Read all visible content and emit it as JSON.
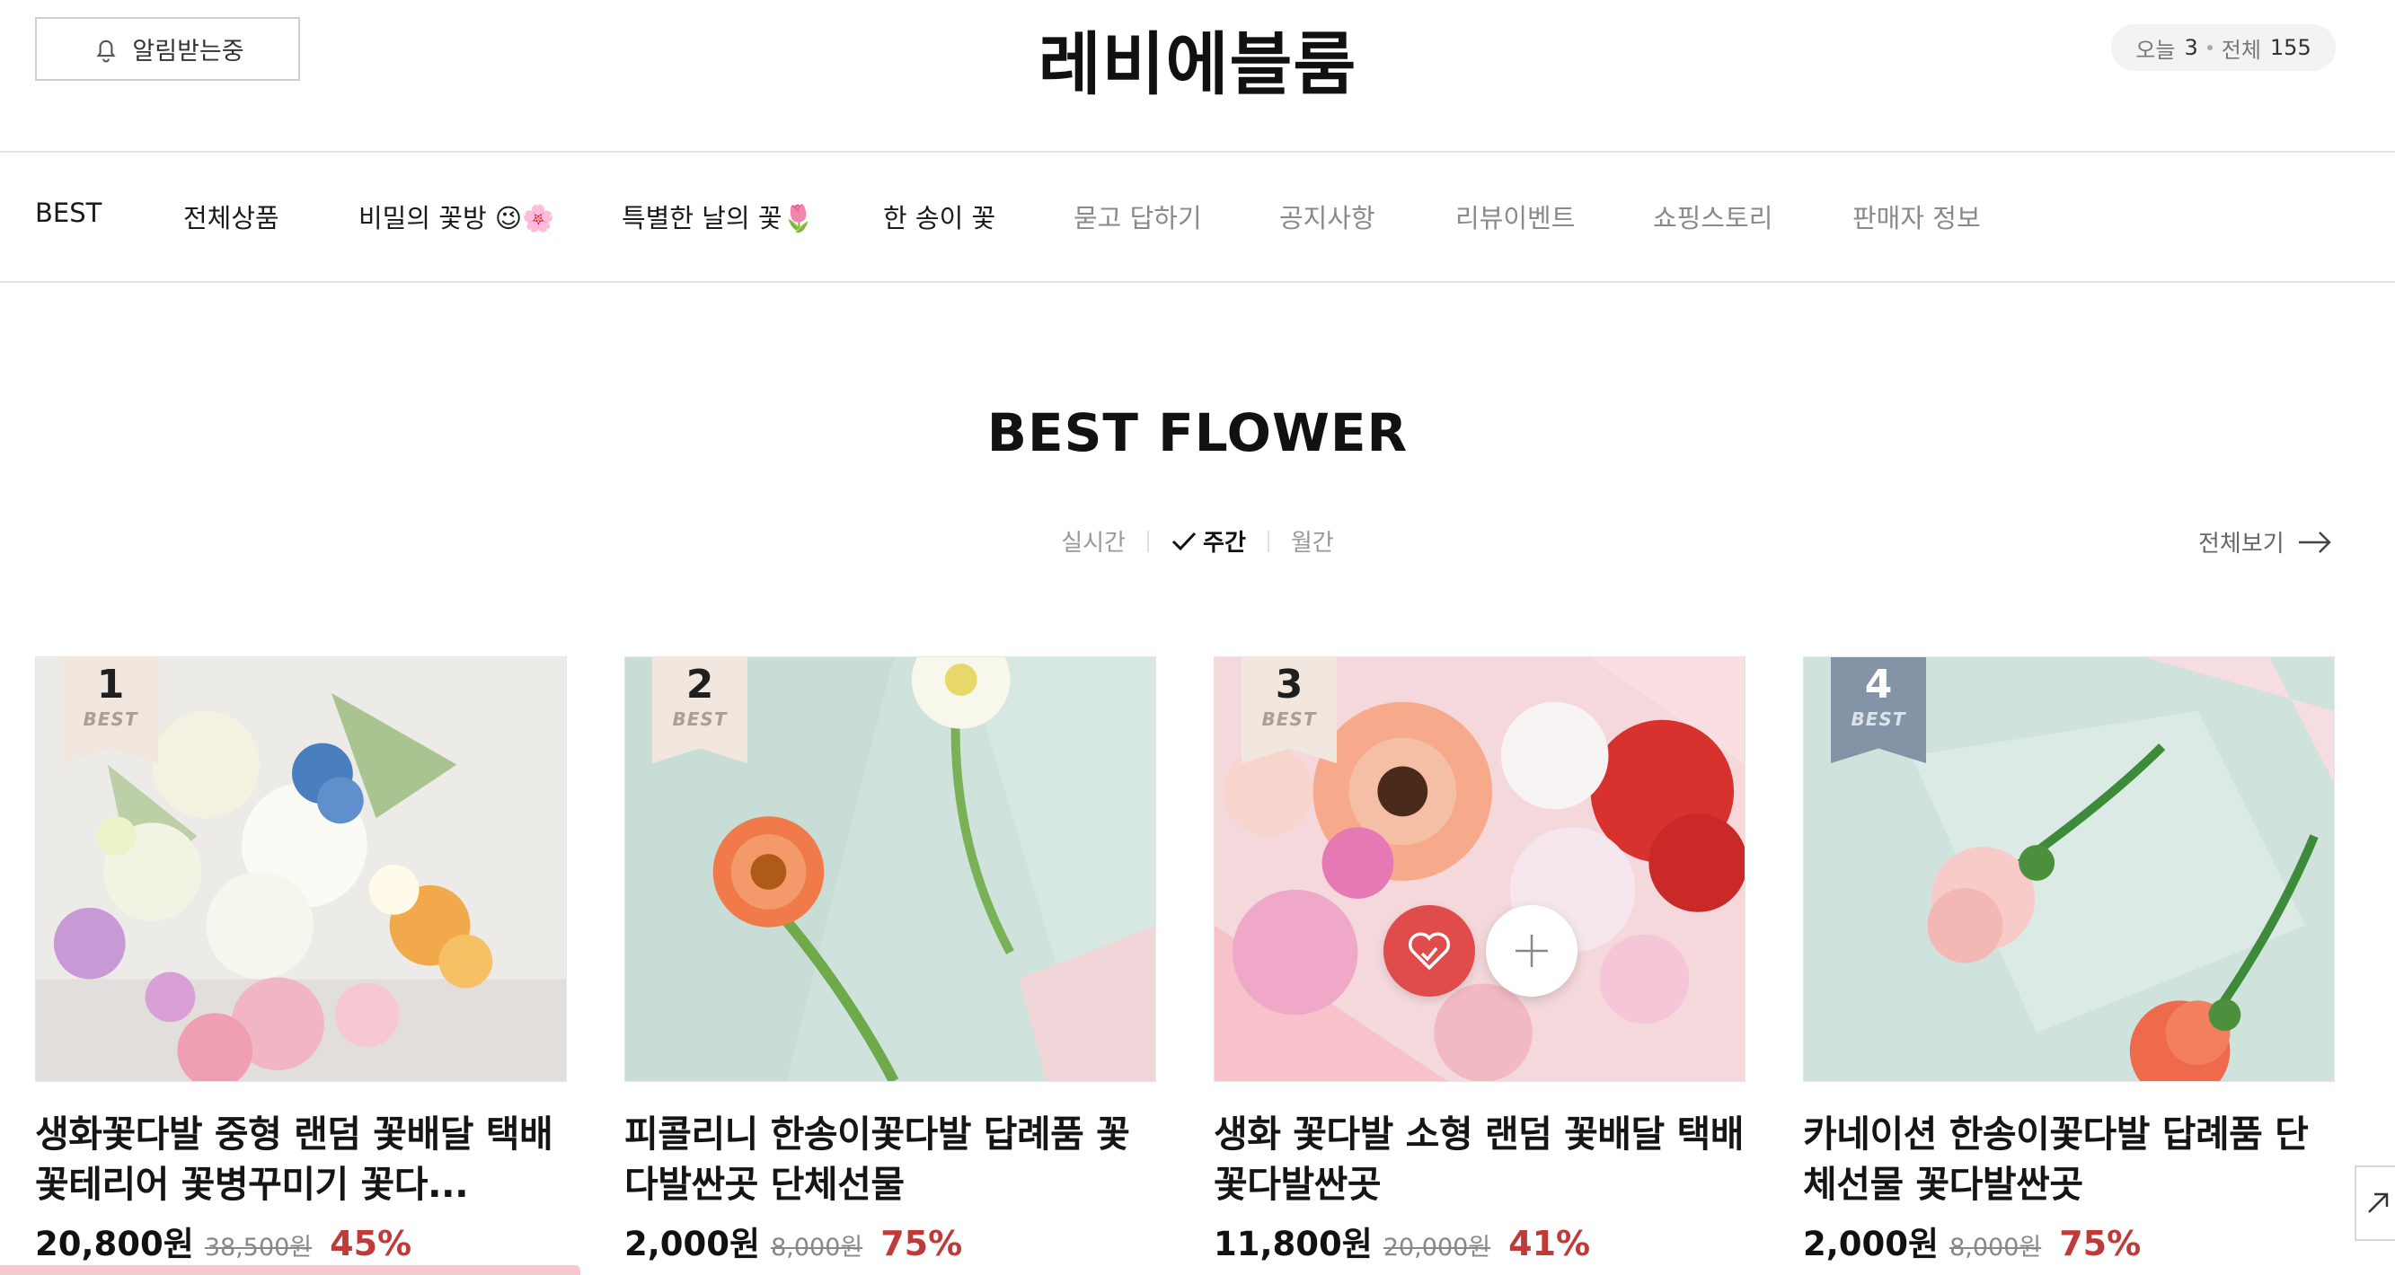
{
  "header": {
    "notify_label": "알림받는중",
    "site_title": "레비에블룸",
    "today_label": "오늘",
    "today_count": "3",
    "total_label": "전체",
    "total_count": "155"
  },
  "nav": {
    "items": [
      {
        "label": "BEST"
      },
      {
        "label": "전체상품"
      },
      {
        "label": "비밀의 꽃방 😉🌸"
      },
      {
        "label": "특별한 날의 꽃🌷"
      },
      {
        "label": "한 송이 꽃"
      },
      {
        "label": "묻고 답하기"
      },
      {
        "label": "공지사항"
      },
      {
        "label": "리뷰이벤트"
      },
      {
        "label": "쇼핑스토리"
      },
      {
        "label": "판매자 정보"
      }
    ]
  },
  "section": {
    "title": "BEST FLOWER",
    "tabs": [
      {
        "label": "실시간",
        "active": false
      },
      {
        "label": "주간",
        "active": true
      },
      {
        "label": "월간",
        "active": false
      }
    ],
    "view_all": "전체보기"
  },
  "products": [
    {
      "rank": "1",
      "badge": "BEST",
      "name": "생화꽃다발 중형 랜덤 꽃배달 택배 꽃테리어 꽃병꾸미기 꽃다...",
      "price": "20,800원",
      "original": "38,500원",
      "discount": "45%"
    },
    {
      "rank": "2",
      "badge": "BEST",
      "name": "피콜리니 한송이꽃다발 답례품 꽃다발싼곳 단체선물",
      "price": "2,000원",
      "original": "8,000원",
      "discount": "75%"
    },
    {
      "rank": "3",
      "badge": "BEST",
      "name": "생화 꽃다발 소형 랜덤 꽃배달 택배 꽃다발싼곳",
      "price": "11,800원",
      "original": "20,000원",
      "discount": "41%"
    },
    {
      "rank": "4",
      "badge": "BEST",
      "name": "카네이션 한송이꽃다발 답례품 단체선물 꽃다발싼곳",
      "price": "2,000원",
      "original": "8,000원",
      "discount": "75%"
    }
  ],
  "colors": {
    "discount": "#c13a3a",
    "heart_button": "#e04c4c",
    "rank_badge_beige": "#f1e7df",
    "rank_badge_grey": "#8593a6"
  },
  "icons": {
    "notify": "bell-icon",
    "active_tab": "check-icon",
    "view_all": "arrow-right-icon",
    "wishlist": "heart-icon",
    "add": "plus-icon",
    "scroll_top": "arrow-up-icon"
  }
}
